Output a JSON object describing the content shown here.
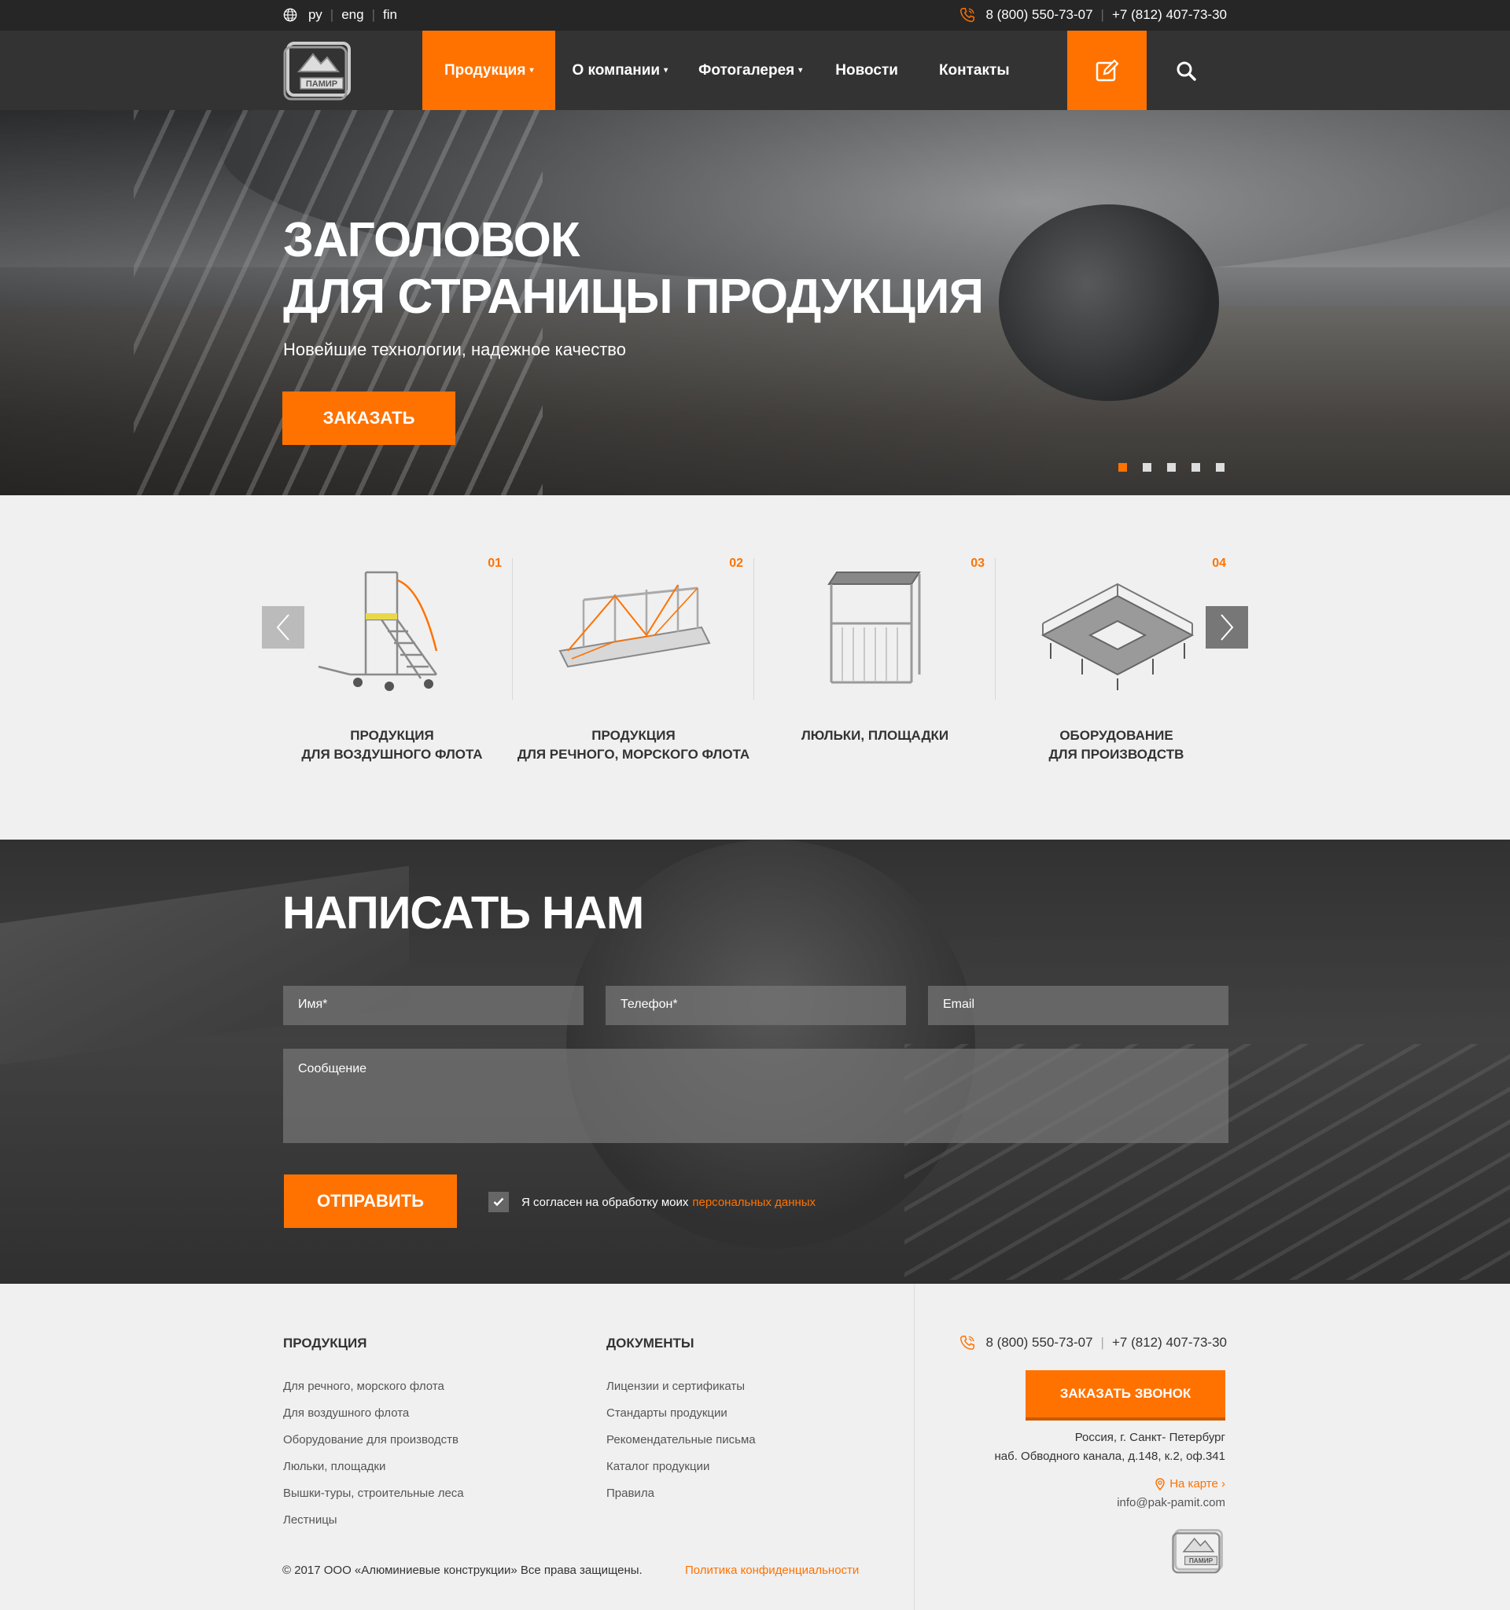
{
  "topbar": {
    "langs": [
      "ру",
      "eng",
      "fin"
    ],
    "phone1": "8 (800) 550-73-07",
    "phone2": "+7 (812) 407-73-30"
  },
  "nav": {
    "items": [
      {
        "label": "Продукция",
        "caret": "▾"
      },
      {
        "label": "О компании",
        "caret": "▾"
      },
      {
        "label": "Фотогалерея",
        "caret": "▾"
      },
      {
        "label": "Новости",
        "caret": ""
      },
      {
        "label": "Контакты",
        "caret": ""
      }
    ],
    "logo_text": "ПАМИР"
  },
  "hero": {
    "title_line1": "ЗАГОЛОВОК",
    "title_line2": "ДЛЯ СТРАНИЦЫ ПРОДУКЦИЯ",
    "subtitle": "Новейшие технологии, надежное качество",
    "button": "ЗАКАЗАТЬ",
    "slides_count": 5,
    "active_slide": 1
  },
  "products": [
    {
      "num": "01",
      "line1": "ПРОДУКЦИЯ",
      "line2": "ДЛЯ ВОЗДУШНОГО ФЛОТА"
    },
    {
      "num": "02",
      "line1": "ПРОДУКЦИЯ",
      "line2": "ДЛЯ РЕЧНОГО, МОРСКОГО ФЛОТА"
    },
    {
      "num": "03",
      "line1": "ЛЮЛЬКИ, ПЛОЩАДКИ",
      "line2": ""
    },
    {
      "num": "04",
      "line1": "ОБОРУДОВАНИЕ",
      "line2": "ДЛЯ ПРОИЗВОДСТВ"
    }
  ],
  "contact": {
    "title": "НАПИСАТЬ НАМ",
    "name_placeholder": "Имя*",
    "phone_placeholder": "Телефон*",
    "email_placeholder": "Email",
    "message_placeholder": "Сообщение",
    "send_button": "ОТПРАВИТЬ",
    "agree_text": "Я согласен на обработку моих",
    "agree_link": "персональных данных",
    "agree_checked": true
  },
  "footer": {
    "col1_title": "ПРОДУКЦИЯ",
    "col1_links": [
      "Для речного, морского флота",
      "Для воздушного флота",
      "Оборудование для производств",
      "Люльки, площадки",
      "Вышки-туры, строительные леса",
      "Лестницы"
    ],
    "col2_title": "ДОКУМЕНТЫ",
    "col2_links": [
      "Лицензии и сертификаты",
      "Стандарты продукции",
      "Рекомендательные письма",
      "Каталог продукции",
      "Правила"
    ],
    "copyright": "© 2017 ООО «Алюминиевые конструкции» Все права защищены.",
    "policy": "Политика конфиденциальности",
    "phone1": "8 (800) 550-73-07",
    "phone2": "+7 (812) 407-73-30",
    "callback_button": "ЗАКАЗАТЬ ЗВОНОК",
    "address_line1": "Россия, г. Санкт- Петербург",
    "address_line2": "наб. Обводного канала, д.148, к.2, оф.341",
    "map_link": "На карте ›",
    "email": "info@pak-pamit.com"
  },
  "colors": {
    "accent": "#ff7200",
    "dark": "#333333",
    "topbar": "#262626",
    "light_bg": "#f0f0f0"
  }
}
